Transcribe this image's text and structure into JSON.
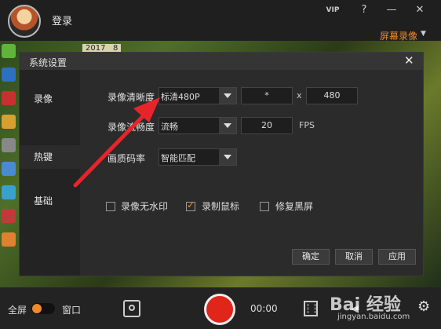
{
  "header": {
    "login_label": "登录",
    "vip_label": "VIP",
    "help_icon": "?",
    "minimize_icon": "—",
    "close_icon": "✕",
    "mode_label": "屏幕录像",
    "mode_caret": "▼"
  },
  "desktop": {
    "clock_text": "2017",
    "clock_digit": "8"
  },
  "dialog": {
    "title": "系统设置",
    "close_icon": "✕",
    "sidebar": [
      {
        "label": "录像"
      },
      {
        "label": "热键"
      },
      {
        "label": "基础"
      }
    ],
    "rows": {
      "clarity_label": "录像清晰度",
      "clarity_value": "标清480P",
      "width_value": "*",
      "x_label": "x",
      "height_value": "480",
      "fluency_label": "录像流畅度",
      "fluency_value": "流畅",
      "fps_value": "20",
      "fps_label": "FPS",
      "bitrate_label": "画质码率",
      "bitrate_value": "智能匹配"
    },
    "checkboxes": [
      {
        "label": "录像无水印",
        "checked": false
      },
      {
        "label": "录制鼠标",
        "checked": true
      },
      {
        "label": "修复黑屏",
        "checked": false
      }
    ],
    "buttons": {
      "ok": "确定",
      "cancel": "取消",
      "apply": "应用"
    }
  },
  "bottombar": {
    "fullscreen_label": "全屏",
    "window_label": "窗口",
    "timer": "00:00",
    "watermark_text": "Bai 经验",
    "watermark_url": "jingyan.baidu.com"
  },
  "colors": {
    "accent": "#f08a2a",
    "record": "#e0261b",
    "arrow": "#e8242b"
  }
}
